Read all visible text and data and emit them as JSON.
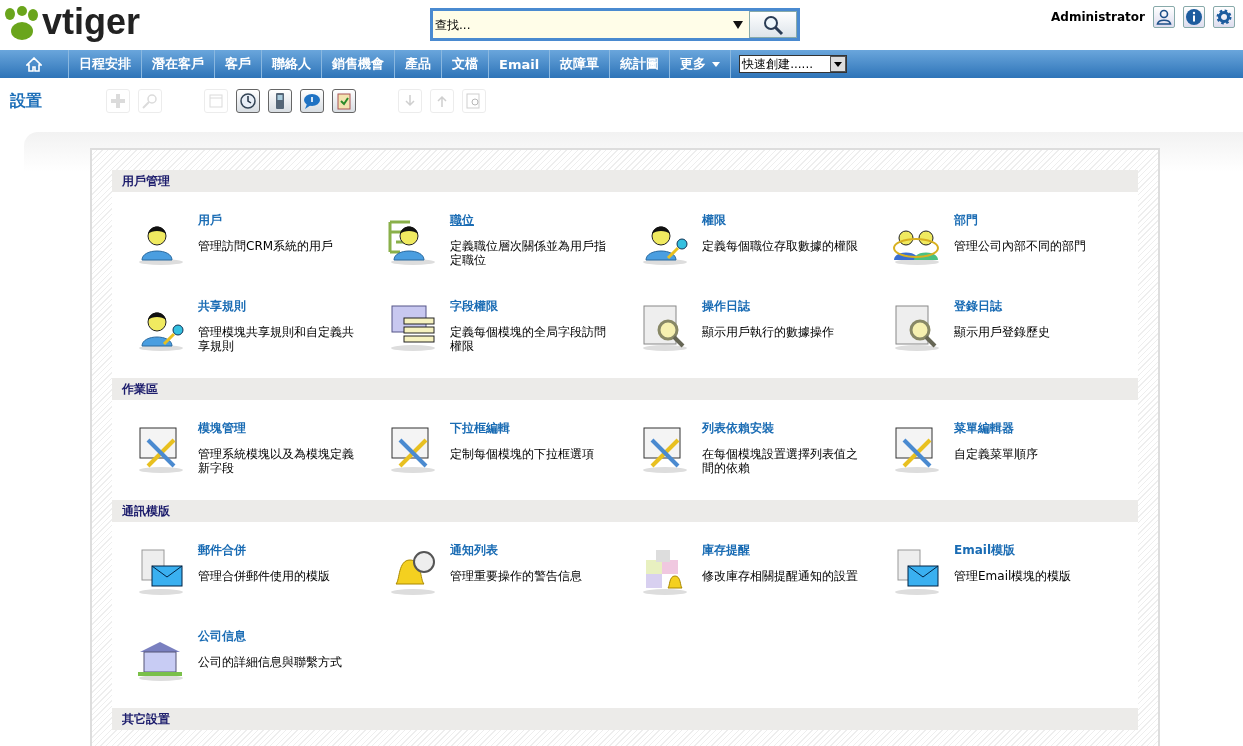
{
  "header": {
    "logo": "vtiger",
    "search": {
      "placeholder": "查找..."
    },
    "user": "Administrator"
  },
  "nav": {
    "items": [
      {
        "label": "日程安排",
        "selected": false
      },
      {
        "label": "潛在客戶",
        "selected": false
      },
      {
        "label": "客戶",
        "selected": false
      },
      {
        "label": "聯絡人",
        "selected": false
      },
      {
        "label": "銷售機會",
        "selected": false
      },
      {
        "label": "產品",
        "selected": false
      },
      {
        "label": "文檔",
        "selected": false
      },
      {
        "label": "Email",
        "selected": false
      },
      {
        "label": "故障單",
        "selected": false
      },
      {
        "label": "統計圖",
        "selected": false
      },
      {
        "label": "更多",
        "selected": false
      }
    ],
    "quick_create": "快速創建......"
  },
  "page_title": "設置",
  "toolbar": [
    {
      "disabled": true
    },
    {
      "disabled": true
    },
    {
      "disabled": true
    },
    {
      "disabled": false
    },
    {
      "disabled": false
    },
    {
      "disabled": false
    },
    {
      "disabled": false
    },
    {
      "disabled": true
    },
    {
      "disabled": true
    },
    {
      "disabled": true
    }
  ],
  "sections": [
    {
      "title": "用戶管理",
      "items": [
        {
          "title": "用戶",
          "desc": "管理訪問CRM系統的用戶",
          "hovered": false
        },
        {
          "title": "職位",
          "desc": "定義職位層次關係並為用戶指定職位",
          "hovered": true
        },
        {
          "title": "權限",
          "desc": "定義每個職位存取數據的權限",
          "hovered": false
        },
        {
          "title": "部門",
          "desc": "管理公司內部不同的部門",
          "hovered": false
        },
        {
          "title": "共享規則",
          "desc": "管理模塊共享規則和自定義共享規則",
          "hovered": false
        },
        {
          "title": "字段權限",
          "desc": "定義每個模塊的全局字段訪問權限",
          "hovered": false
        },
        {
          "title": "操作日誌",
          "desc": "顯示用戶執行的數據操作",
          "hovered": false
        },
        {
          "title": "登錄日誌",
          "desc": "顯示用戶登錄歷史",
          "hovered": false
        }
      ]
    },
    {
      "title": "作業區",
      "items": [
        {
          "title": "模塊管理",
          "desc": "管理系統模塊以及為模塊定義新字段",
          "hovered": false
        },
        {
          "title": "下拉框編輯",
          "desc": "定制每個模塊的下拉框選項",
          "hovered": false
        },
        {
          "title": "列表依賴安裝",
          "desc": "在每個模塊設置選擇列表值之間的依賴",
          "hovered": false
        },
        {
          "title": "菜單編輯器",
          "desc": "自定義菜單順序",
          "hovered": false
        }
      ]
    },
    {
      "title": "通訊模版",
      "items": [
        {
          "title": "郵件合併",
          "desc": "管理合併郵件使用的模版",
          "hovered": false
        },
        {
          "title": "通知列表",
          "desc": "管理重要操作的警告信息",
          "hovered": false
        },
        {
          "title": "庫存提醒",
          "desc": "修改庫存相關提醒通知的設置",
          "hovered": false
        },
        {
          "title": "Email模版",
          "desc": "管理Email模塊的模版",
          "hovered": false
        },
        {
          "title": "公司信息",
          "desc": "公司的詳細信息與聯繫方式",
          "hovered": false
        }
      ]
    },
    {
      "title": "其它設置"
    }
  ]
}
